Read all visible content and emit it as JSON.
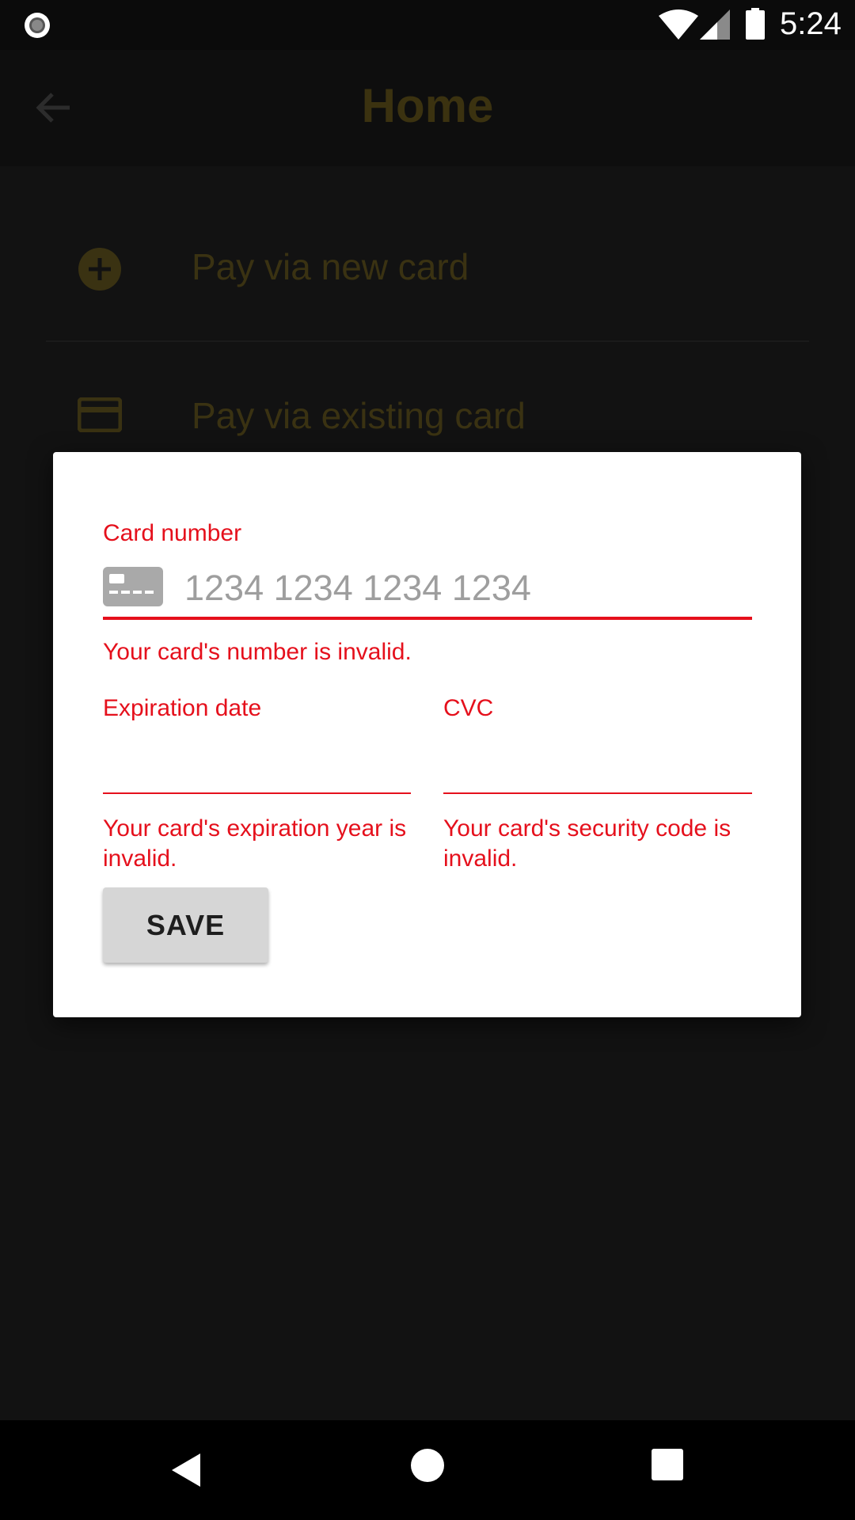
{
  "status_bar": {
    "time": "5:24",
    "icons": [
      "record-icon",
      "wifi-icon",
      "cell-signal-icon",
      "battery-icon"
    ]
  },
  "toolbar": {
    "title": "Home",
    "back_icon": "arrow-back-icon"
  },
  "menu": {
    "items": [
      {
        "label": "Pay via new card",
        "icon": "add-circle-icon"
      },
      {
        "label": "Pay via existing card",
        "icon": "credit-card-icon"
      }
    ]
  },
  "dialog": {
    "card_number": {
      "label": "Card number",
      "placeholder": "1234 1234 1234 1234",
      "value": "",
      "error": "Your card's number is invalid.",
      "icon": "card-brand-icon"
    },
    "expiration": {
      "label": "Expiration date",
      "value": "",
      "error": "Your card's expiration year is invalid."
    },
    "cvc": {
      "label": "CVC",
      "value": "",
      "error": "Your card's security code is invalid."
    },
    "save_label": "SAVE"
  },
  "nav_bar": {
    "icons": [
      "nav-back-icon",
      "nav-home-icon",
      "nav-recents-icon"
    ]
  },
  "colors": {
    "error": "#e5101c",
    "accent_dimmed": "#3a3212",
    "background": "#121212",
    "dialog": "#ffffff",
    "button": "#d6d6d6"
  }
}
